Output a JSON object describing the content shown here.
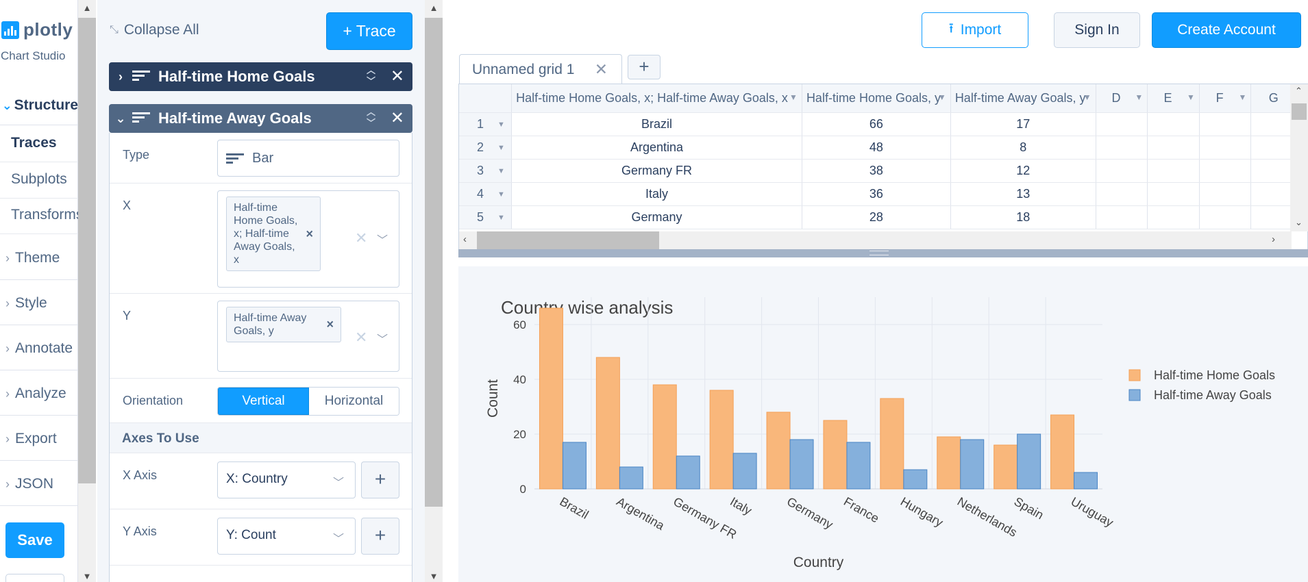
{
  "app": {
    "logo_text": "plotly",
    "logo_sub": "Chart Studio"
  },
  "nav": {
    "structure": "Structure",
    "sub_items": [
      "Traces",
      "Subplots",
      "Transforms"
    ],
    "groups": [
      "Theme",
      "Style",
      "Annotate",
      "Analyze",
      "Export",
      "JSON"
    ],
    "save": "Save"
  },
  "panel": {
    "collapse_all": "Collapse All",
    "add_trace": "+ Trace",
    "traces": [
      {
        "name": "Half-time Home Goals",
        "expanded": false
      },
      {
        "name": "Half-time Away Goals",
        "expanded": true
      }
    ],
    "fields": {
      "type_label": "Type",
      "type_value": "Bar",
      "x_label": "X",
      "x_tag": "Half-time Home Goals, x; Half-time Away Goals, x",
      "y_label": "Y",
      "y_tag": "Half-time Away Goals, y",
      "orientation_label": "Orientation",
      "orientation_options": [
        "Vertical",
        "Horizontal"
      ],
      "orientation_selected": "Vertical",
      "axes_header": "Axes To Use",
      "x_axis_label": "X Axis",
      "x_axis_value": "X: Country",
      "y_axis_label": "Y Axis",
      "y_axis_value": "Y: Count"
    }
  },
  "topbar": {
    "import": "Import",
    "sign_in": "Sign In",
    "create_account": "Create Account"
  },
  "grid": {
    "tab_name": "Unnamed grid 1",
    "columns": [
      "Half-time Home Goals, x; Half-time Away Goals, x",
      "Half-time Home Goals, y",
      "Half-time Away Goals, y",
      "D",
      "E",
      "F",
      "G"
    ],
    "rows": [
      {
        "n": "1",
        "x": "Brazil",
        "h": "66",
        "a": "17"
      },
      {
        "n": "2",
        "x": "Argentina",
        "h": "48",
        "a": "8"
      },
      {
        "n": "3",
        "x": "Germany FR",
        "h": "38",
        "a": "12"
      },
      {
        "n": "4",
        "x": "Italy",
        "h": "36",
        "a": "13"
      },
      {
        "n": "5",
        "x": "Germany",
        "h": "28",
        "a": "18"
      }
    ]
  },
  "colors": {
    "accent": "#119dff",
    "home": "#f9b77b",
    "home_line": "#f4a057",
    "away": "#85b0dc",
    "away_line": "#4a85c4"
  },
  "chart_data": {
    "type": "bar",
    "title": "Country wise analysis",
    "xlabel": "Country",
    "ylabel": "Count",
    "categories": [
      "Brazil",
      "Argentina",
      "Germany FR",
      "Italy",
      "Germany",
      "France",
      "Hungary",
      "Netherlands",
      "Spain",
      "Uruguay"
    ],
    "series": [
      {
        "name": "Half-time Home Goals",
        "values": [
          66,
          48,
          38,
          36,
          28,
          25,
          33,
          19,
          16,
          27
        ]
      },
      {
        "name": "Half-time Away Goals",
        "values": [
          17,
          8,
          12,
          13,
          18,
          17,
          7,
          18,
          20,
          6
        ]
      }
    ],
    "yticks": [
      0,
      20,
      40,
      60
    ],
    "ylim": [
      0,
      70
    ],
    "grid": true,
    "legend_position": "right"
  }
}
